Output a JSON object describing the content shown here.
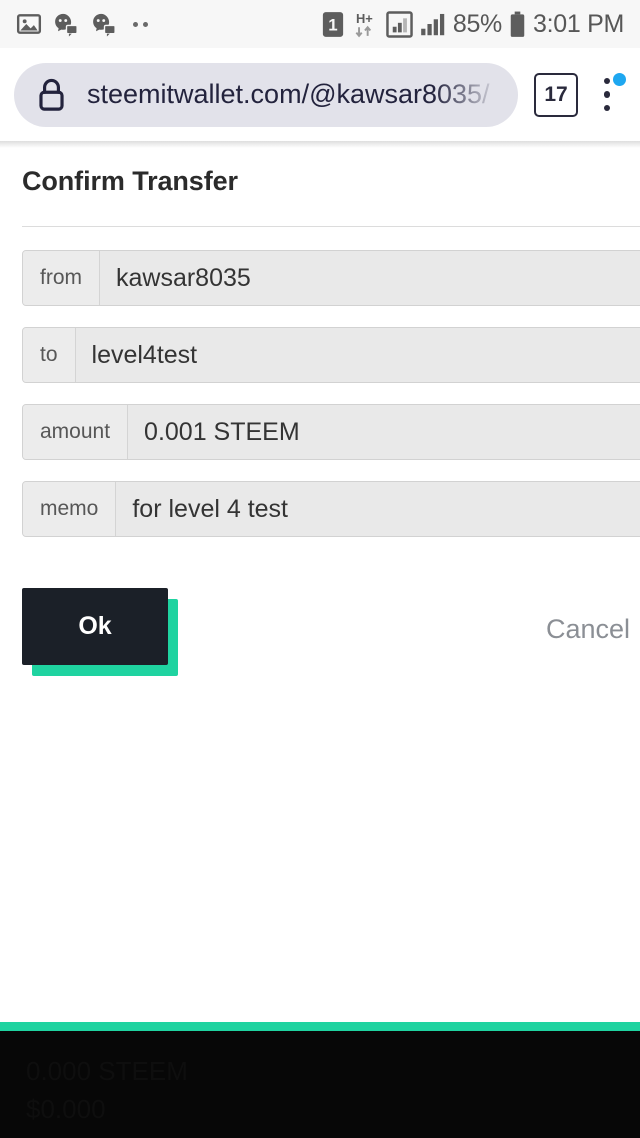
{
  "status_bar": {
    "left_icons": [
      {
        "name": "image-icon",
        "glyph": "ὛC"
      },
      {
        "name": "discord-notification-icon",
        "glyph": "discord"
      },
      {
        "name": "discord-notification-icon-2",
        "glyph": "discord"
      },
      {
        "name": "more-notifications-icon",
        "glyph": "··"
      }
    ],
    "sim_indicator": "1",
    "network_type": "H+",
    "battery_percent": "85%",
    "clock": "3:01 PM"
  },
  "browser": {
    "lock_icon": "lock-icon",
    "url": "steemitwallet.com/@kawsar8035/",
    "tab_count": "17",
    "menu_icon": "overflow-menu-icon",
    "menu_has_update_badge": true
  },
  "page": {
    "title": "Confirm Transfer",
    "fields": [
      {
        "label": "from",
        "value": "kawsar8035"
      },
      {
        "label": "to",
        "value": "level4test"
      },
      {
        "label": "amount",
        "value": "0.001 STEEM"
      },
      {
        "label": "memo",
        "value": "for level 4 test"
      }
    ],
    "confirm_label": "Ok",
    "cancel_label": "Cancel"
  },
  "footer": {
    "lines": [
      "0.000 STEEM",
      "$0.000"
    ]
  },
  "colors": {
    "accent_teal": "#1fd3a0",
    "button_dark": "#1b2028",
    "url_text": "#23233d",
    "badge_blue": "#1ea7f0",
    "field_bg": "#e9e9e9",
    "footer_bg": "#070707"
  }
}
